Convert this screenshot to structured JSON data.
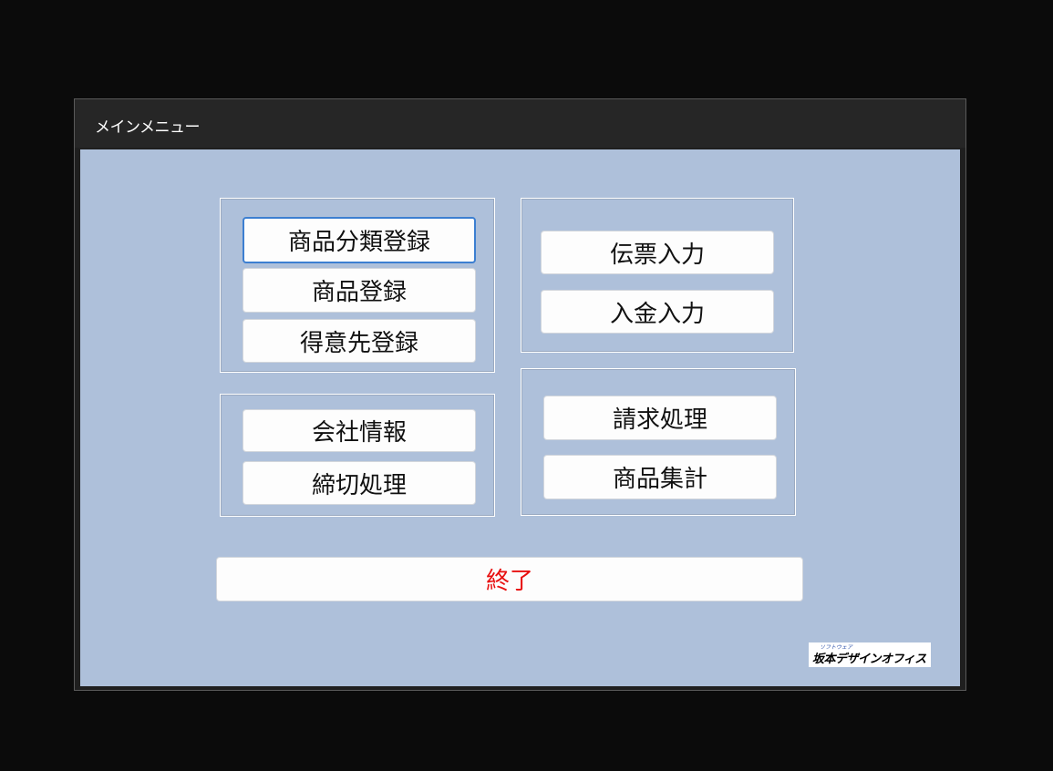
{
  "window": {
    "title": "メインメニュー"
  },
  "groups": {
    "master": {
      "buttons": [
        "商品分類登録",
        "商品登録",
        "得意先登録"
      ]
    },
    "entry": {
      "buttons": [
        "伝票入力",
        "入金入力"
      ]
    },
    "company": {
      "buttons": [
        "会社情報",
        "締切処理"
      ]
    },
    "billing": {
      "buttons": [
        "請求処理",
        "商品集計"
      ]
    }
  },
  "exit_button": {
    "label": "終了",
    "color": "#e81010"
  },
  "logo": {
    "small_text": "ソフトウェア",
    "main_text": "坂本デザインオフィス"
  },
  "colors": {
    "client_background": "#aec0da",
    "focus_border": "#3c7fd1"
  }
}
